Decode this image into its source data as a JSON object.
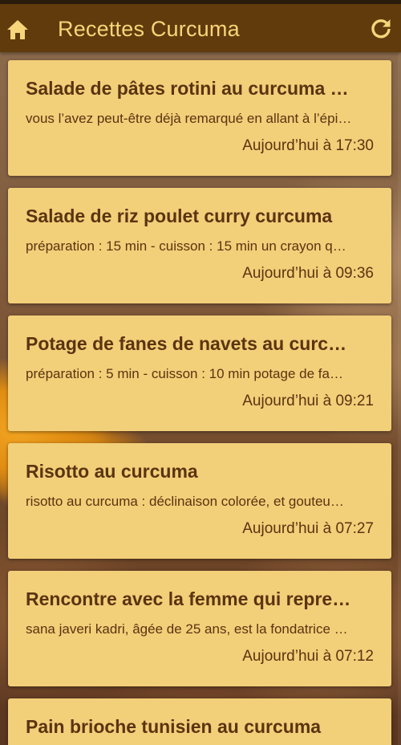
{
  "app_bar": {
    "title": "Recettes Curcuma",
    "home_icon": "home-icon",
    "refresh_icon": "refresh-icon"
  },
  "articles": [
    {
      "title": "Salade de pâtes rotini au curcuma …",
      "excerpt": "vous l’avez peut-être déjà remarqué en allant à l’épi…",
      "time": "Aujourd’hui à 17:30"
    },
    {
      "title": "Salade de riz poulet curry curcuma",
      "excerpt": "préparation : 15 min - cuisson : 15 min un crayon q…",
      "time": "Aujourd’hui à 09:36"
    },
    {
      "title": "Potage de fanes de navets au curc…",
      "excerpt": "préparation : 5 min - cuisson : 10 min potage de fa…",
      "time": "Aujourd’hui à 09:21"
    },
    {
      "title": "Risotto au curcuma",
      "excerpt": "risotto au curcuma : déclinaison colorée, et gouteu…",
      "time": "Aujourd’hui à 07:27"
    },
    {
      "title": "Rencontre avec la femme qui repre…",
      "excerpt": "sana javeri kadri, âgée de 25 ans, est la fondatrice …",
      "time": "Aujourd’hui à 07:12"
    },
    {
      "title": "Pain brioche tunisien au curcuma",
      "excerpt": "",
      "time": ""
    }
  ],
  "colors": {
    "app_bar": "#613b0c",
    "title_text": "#f7d57a",
    "card_background": "#f2cf79",
    "card_text": "#5a3410"
  }
}
